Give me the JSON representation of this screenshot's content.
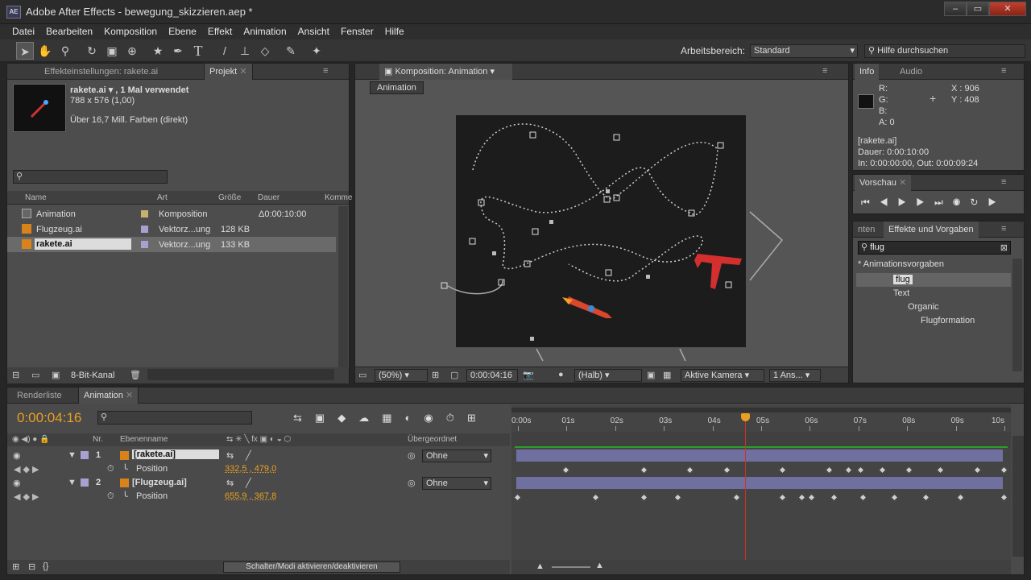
{
  "titlebar": {
    "icon": "AE",
    "title": "Adobe After Effects - bewegung_skizzieren.aep *",
    "min": "–",
    "max": "▭",
    "close": "✕"
  },
  "menu": [
    "Datei",
    "Bearbeiten",
    "Komposition",
    "Ebene",
    "Effekt",
    "Animation",
    "Ansicht",
    "Fenster",
    "Hilfe"
  ],
  "toolbar": {
    "workspace_label": "Arbeitsbereich:",
    "workspace_value": "Standard",
    "help_placeholder": "Hilfe durchsuchen"
  },
  "project_panel": {
    "tabs": [
      "Effekteinstellungen: rakete.ai",
      "Projekt"
    ],
    "preview_name": "rakete.ai ▾ , 1 Mal verwendet",
    "preview_dims": "788 x 576 (1,00)",
    "preview_colors": "Über 16,7 Mill. Farben (direkt)",
    "columns": [
      "Name",
      "Art",
      "Größe",
      "Dauer",
      "Komme"
    ],
    "rows": [
      {
        "name": "Animation",
        "type": "Komposition",
        "size": "",
        "duration": "Δ0:00:10:00"
      },
      {
        "name": "Flugzeug.ai",
        "type": "Vektorz...ung",
        "size": "128 KB",
        "duration": ""
      },
      {
        "name": "rakete.ai",
        "type": "Vektorz...ung",
        "size": "133 KB",
        "duration": ""
      }
    ],
    "bit_depth": "8-Bit-Kanal"
  },
  "comp_panel": {
    "tab": "Komposition: Animation",
    "breadcrumb": "Animation",
    "zoom": "(50%)",
    "timecode": "0:00:04:16",
    "resolution": "(Halb)",
    "camera": "Aktive Kamera",
    "views": "1 Ans..."
  },
  "info_panel": {
    "tabs": [
      "Info",
      "Audio"
    ],
    "r": "R:",
    "g": "G:",
    "b": "B:",
    "a": "A:  0",
    "x": "X : 906",
    "y": "Y : 408",
    "layer": "[rakete.ai]",
    "duration": "Dauer: 0:00:10:00",
    "inout": "In: 0:00:00:00, Out: 0:00:09:24"
  },
  "preview_panel": {
    "tab": "Vorschau"
  },
  "effects_panel": {
    "tabs": [
      "nten",
      "Effekte und Vorgaben"
    ],
    "search_value": "flug",
    "tree": [
      {
        "label": "* Animationsvorgaben",
        "level": 0
      },
      {
        "label": "flug",
        "level": 1
      },
      {
        "label": "Text",
        "level": 1
      },
      {
        "label": "Organic",
        "level": 2
      },
      {
        "label": "Flugformation",
        "level": 3
      }
    ]
  },
  "timeline": {
    "tabs": [
      "Renderliste",
      "Animation"
    ],
    "timecode": "0:00:04:16",
    "col_nr": "Nr.",
    "col_name": "Ebenenname",
    "col_parent": "Übergeordnet",
    "ruler": [
      "0:00s",
      "01s",
      "02s",
      "03s",
      "04s",
      "05s",
      "06s",
      "07s",
      "08s",
      "09s",
      "10s"
    ],
    "current_time_fraction": 0.467,
    "layers": [
      {
        "nr": "1",
        "name": "[rakete.ai]",
        "parent": "Ohne",
        "prop": "Position",
        "value": "332,5 , 479,0",
        "keys": [
          0.1,
          0.26,
          0.355,
          0.43,
          0.545,
          0.64,
          0.68,
          0.705,
          0.75,
          0.805,
          0.87,
          0.945,
          1.0
        ]
      },
      {
        "nr": "2",
        "name": "[Flugzeug.ai]",
        "parent": "Ohne",
        "prop": "Position",
        "value": "655,9 , 367,8",
        "keys": [
          0.0,
          0.16,
          0.26,
          0.33,
          0.45,
          0.545,
          0.585,
          0.605,
          0.65,
          0.71,
          0.775,
          0.84,
          0.91,
          1.0
        ]
      }
    ],
    "switches_label": "Schalter/Modi aktivieren/deaktivieren"
  },
  "colors": {
    "accent": "#e8a020",
    "playhead": "#d0302a",
    "layer_bar": "#7070a0",
    "work_area": "#2aa02a"
  }
}
